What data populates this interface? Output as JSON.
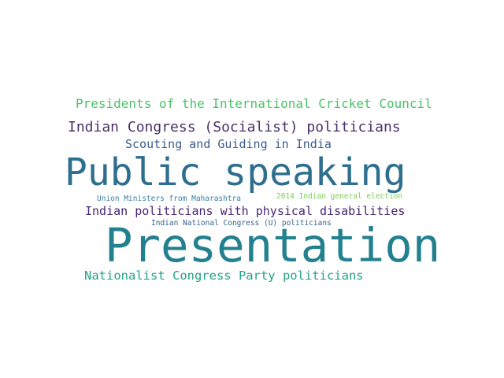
{
  "words": [
    {
      "key": "cricket",
      "text": "Presidents of the International Cricket Council",
      "color": "#4cc26a"
    },
    {
      "key": "socialist",
      "text": "Indian Congress (Socialist) politicians",
      "color": "#48316a"
    },
    {
      "key": "scouting",
      "text": "Scouting and Guiding in India",
      "color": "#3b5c8c"
    },
    {
      "key": "public",
      "text": "Public speaking",
      "color": "#2e6e8e"
    },
    {
      "key": "union",
      "text": "Union Ministers from Maharashtra",
      "color": "#3a7fa1"
    },
    {
      "key": "election",
      "text": "2014 Indian general election",
      "color": "#7ad151"
    },
    {
      "key": "disab",
      "text": "Indian politicians with physical disabilities",
      "color": "#482677"
    },
    {
      "key": "incu",
      "text": "Indian National Congress (U) politicians",
      "color": "#33638d"
    },
    {
      "key": "present",
      "text": "Presentation",
      "color": "#23808e"
    },
    {
      "key": "ncp",
      "text": "Nationalist Congress Party politicians",
      "color": "#22a287"
    }
  ]
}
